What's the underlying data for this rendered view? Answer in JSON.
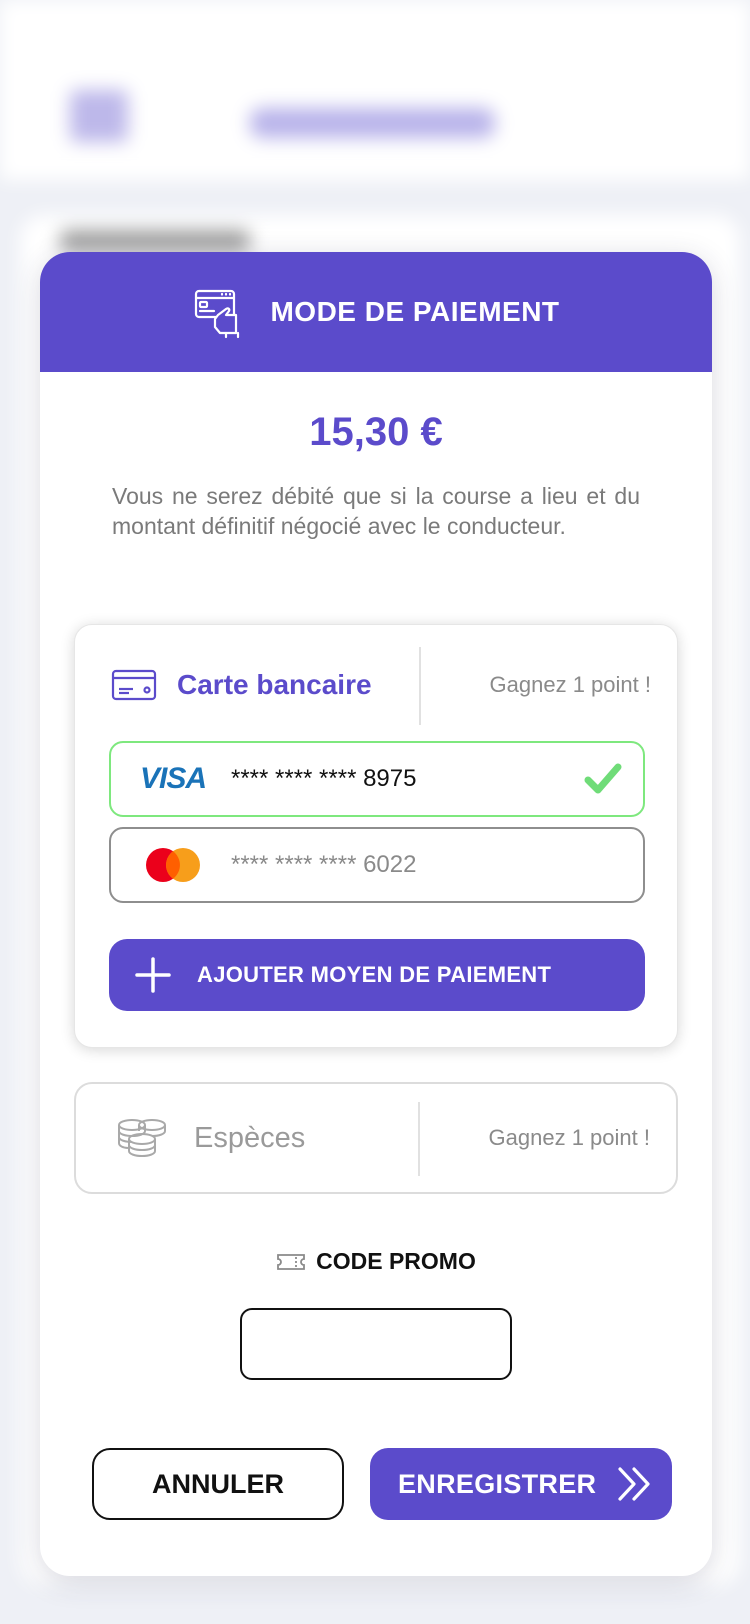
{
  "colors": {
    "accent": "#5b4bcb",
    "success": "#7ee87e",
    "muted_text": "#8a8a8a"
  },
  "modal": {
    "header_icon": "card-in-hand-icon",
    "title": "MODE DE PAIEMENT",
    "amount": "15,30 €",
    "info": "Vous ne serez débité que si la course a lieu et du montant définitif négocié avec le conducteur."
  },
  "card_section": {
    "icon": "credit-card-icon",
    "label": "Carte bancaire",
    "reward": "Gagnez 1 point !",
    "cards": [
      {
        "brand": "VISA",
        "brand_icon": "visa-logo-icon",
        "number": "**** **** **** 8975",
        "selected": true,
        "status_icon": "check-icon"
      },
      {
        "brand": "Mastercard",
        "brand_icon": "mastercard-logo-icon",
        "number": "**** **** **** 6022",
        "selected": false
      }
    ],
    "add_button": {
      "icon": "plus-icon",
      "label": "AJOUTER MOYEN DE PAIEMENT"
    }
  },
  "cash_section": {
    "icon": "coins-stack-icon",
    "label": "Espèces",
    "reward": "Gagnez 1 point !"
  },
  "promo": {
    "icon": "ticket-icon",
    "title": "CODE PROMO",
    "value": "",
    "placeholder": ""
  },
  "footer": {
    "cancel_label": "ANNULER",
    "save_label": "ENREGISTRER",
    "save_icon": "double-chevron-right-icon"
  }
}
